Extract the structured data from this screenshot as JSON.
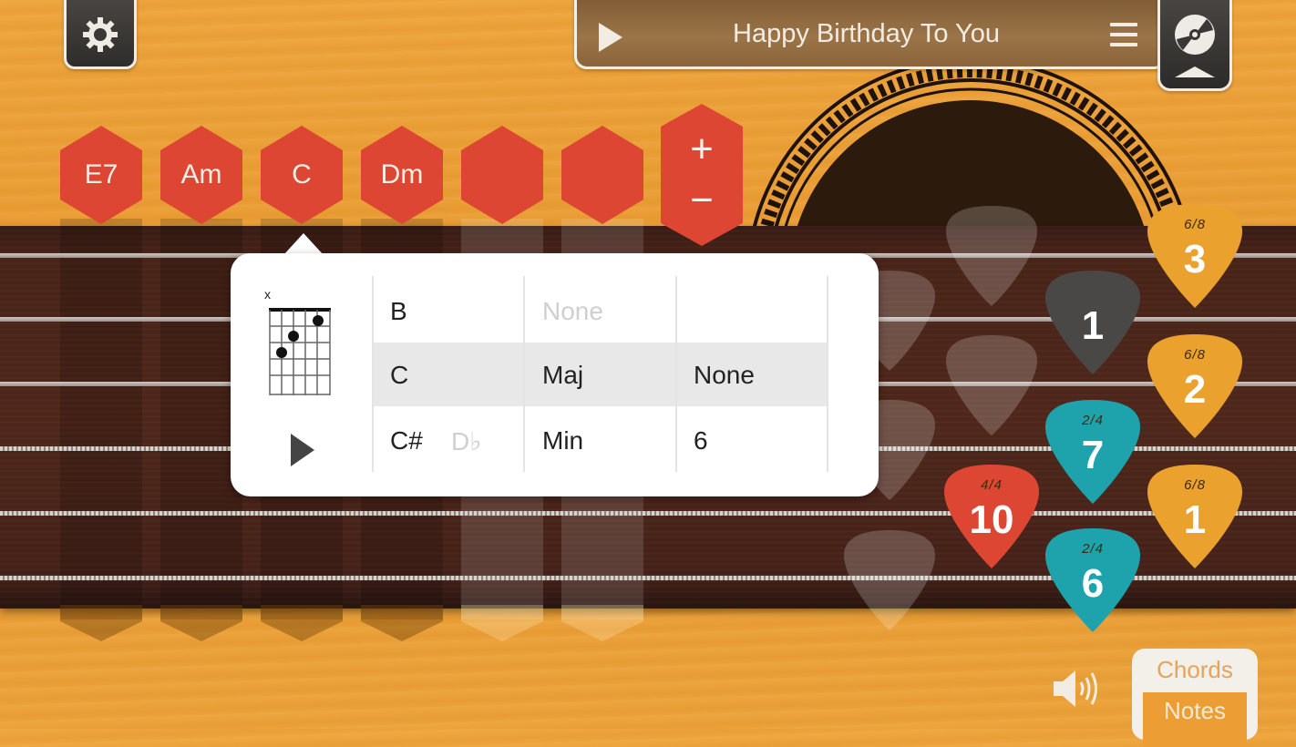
{
  "header": {
    "settings_icon": "gear-icon",
    "song_title": "Happy Birthday To You",
    "play_icon": "play-icon",
    "menu_icon": "hamburger-menu-icon",
    "library_icon": "disc-icon"
  },
  "chord_slots": [
    {
      "label": "E7"
    },
    {
      "label": "Am"
    },
    {
      "label": "C",
      "selected": true
    },
    {
      "label": "Dm"
    },
    {
      "label": ""
    },
    {
      "label": ""
    }
  ],
  "slot_controls": {
    "add_label": "+",
    "remove_label": "−"
  },
  "chord_picker": {
    "diagram": {
      "muted_string_marker": "x",
      "chord": "C"
    },
    "preview_icon": "play-icon",
    "root_column": [
      {
        "value": "B"
      },
      {
        "value": "C",
        "selected": true
      },
      {
        "value": "C#",
        "alt": "D♭"
      }
    ],
    "quality_column": [
      {
        "value": "None",
        "dim": true
      },
      {
        "value": "Maj",
        "selected": true
      },
      {
        "value": "Min"
      }
    ],
    "extension_column": [
      {
        "value": ""
      },
      {
        "value": "None",
        "selected": true
      },
      {
        "value": "6"
      }
    ]
  },
  "patterns": [
    {
      "number": "3",
      "time_signature": "6/8",
      "color": "#eba12e"
    },
    {
      "number": "1",
      "time_signature": "",
      "color": "#4a4846"
    },
    {
      "number": "2",
      "time_signature": "6/8",
      "color": "#eba12e"
    },
    {
      "number": "7",
      "time_signature": "2/4",
      "color": "#1ea3ad"
    },
    {
      "number": "10",
      "time_signature": "4/4",
      "color": "#dc4632"
    },
    {
      "number": "1",
      "time_signature": "6/8",
      "color": "#eba12e"
    },
    {
      "number": "6",
      "time_signature": "2/4",
      "color": "#1ea3ad"
    }
  ],
  "footer": {
    "volume_icon": "speaker-icon",
    "mode_options": [
      "Chords",
      "Notes"
    ],
    "active_mode": "Notes"
  },
  "colors": {
    "wood": "#eba23a",
    "fretboard": "#4b2519",
    "chord_red": "#dc4632"
  }
}
